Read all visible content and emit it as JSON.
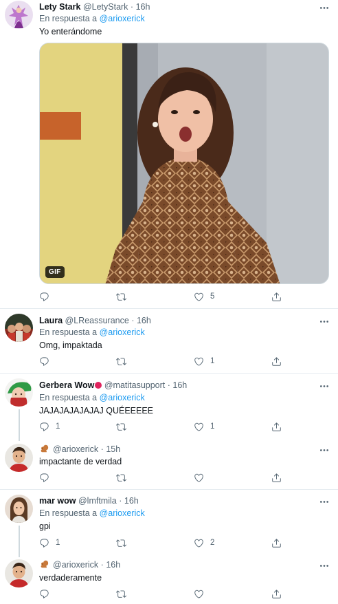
{
  "reply_prefix": "En respuesta a",
  "tweets": [
    {
      "name": "Lety Stark",
      "handle": "@LetyStark",
      "time": "16h",
      "reply_to": "@arioxerick",
      "text": "Yo enterándome",
      "media_badge": "GIF",
      "likes": "5"
    },
    {
      "name": "Laura",
      "handle": "@LReassurance",
      "time": "16h",
      "reply_to": "@arioxerick",
      "text": "Omg, impaktada",
      "likes": "1"
    },
    {
      "name": "Gerbera Wow",
      "handle": "@matitasupport",
      "time": "16h",
      "reply_to": "@arioxerick",
      "text": "JAJAJAJAJAJAJ QUÉEEEEE",
      "replies": "1",
      "likes": "1"
    },
    {
      "handle": "@arioxerick",
      "time": "15h",
      "text": "impactante de verdad"
    },
    {
      "name": "mar wow",
      "handle": "@lmftmila",
      "time": "16h",
      "reply_to": "@arioxerick",
      "text": "gpi",
      "replies": "1",
      "likes": "2"
    },
    {
      "handle": "@arioxerick",
      "time": "16h",
      "text": "verdaderamente"
    }
  ],
  "colors": {
    "accent": "#1d9bf0",
    "secondary_text": "#536471",
    "divider": "#e6ecf0"
  },
  "icons": [
    "reply-icon",
    "retweet-icon",
    "like-icon",
    "share-icon",
    "more-options-icon",
    "squirrel-emoji-icon",
    "red-circle-emoji-icon"
  ]
}
